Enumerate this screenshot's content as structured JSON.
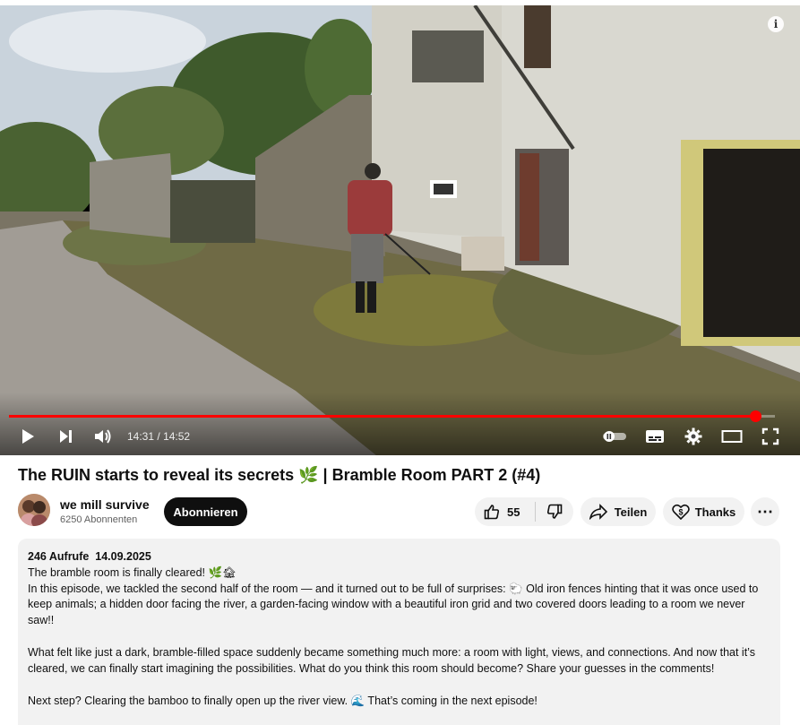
{
  "player": {
    "time_current": "14:31",
    "time_separator": "/",
    "time_total": "14:52",
    "progress_fraction": 0.974,
    "icons": [
      "play-icon",
      "next-icon",
      "volume-icon",
      "autoplay-toggle-icon",
      "subtitles-icon",
      "settings-icon",
      "theater-mode-icon",
      "fullscreen-icon",
      "info-icon"
    ],
    "info_glyph": "i"
  },
  "video": {
    "title": "The RUIN starts to reveal its secrets 🌿 | Bramble Room PART 2 (#4)"
  },
  "channel": {
    "name": "we mill survive",
    "subscribers": "6250 Abonnenten",
    "subscribe_label": "Abonnieren"
  },
  "actions": {
    "like_count": "55",
    "share_label": "Teilen",
    "thanks_label": "Thanks",
    "more_glyph": "⋯"
  },
  "description": {
    "views": "246 Aufrufe",
    "date": "14.09.2025",
    "line1": "The bramble room is finally cleared! 🌿🏚",
    "para1": "In this episode, we tackled the second half of the room — and it turned out to be full of surprises: 🐑 Old iron fences hinting that it was once used to keep animals; a hidden door facing the river, a garden-facing window with a beautiful iron grid and two covered doors leading to a room we never saw!!",
    "para2": "What felt like just a dark, bramble-filled space suddenly became something much more: a room with light, views, and connections. And now that it’s cleared, we can finally start imagining the possibilities. What do you think this room should become? Share your guesses in the comments!",
    "para3": "Next step? Clearing the bamboo to finally open up the river view. 🌊 That’s coming in the next episode!"
  },
  "colors": {
    "accent_red": "#ff0000",
    "pill_bg": "#f2f2f2",
    "subscribe_bg": "#0f0f0f"
  }
}
